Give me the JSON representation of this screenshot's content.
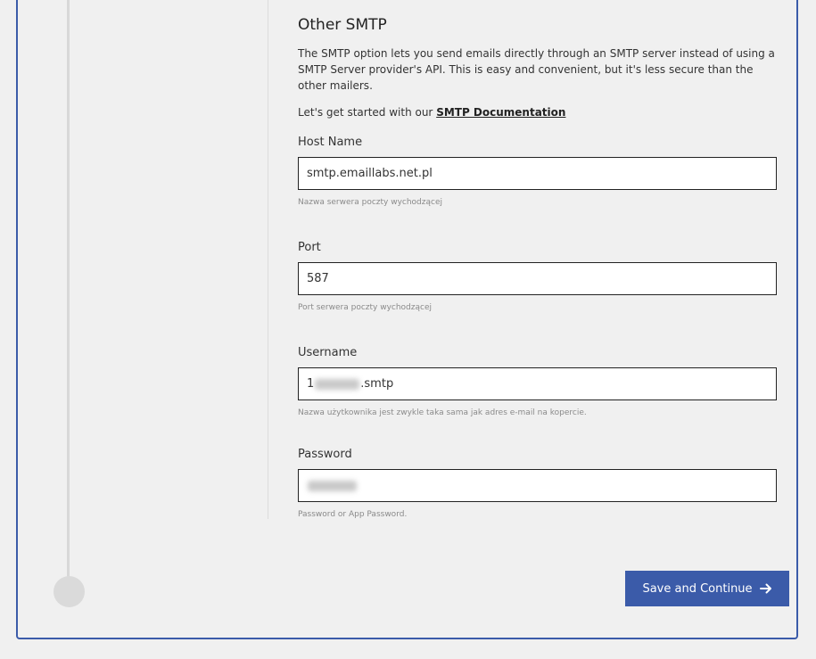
{
  "section": {
    "title": "Other SMTP",
    "description": "The SMTP option lets you send emails directly through an SMTP server instead of using a SMTP Server provider's API. This is easy and convenient, but it's less secure than the other mailers.",
    "intro_text": "Let's get started with our ",
    "doc_link": "SMTP Documentation"
  },
  "fields": {
    "host": {
      "label": "Host Name",
      "value": "smtp.emaillabs.net.pl",
      "hint": "Nazwa serwera poczty wychodzącej"
    },
    "port": {
      "label": "Port",
      "value": "587",
      "hint": "Port serwera poczty wychodzącej"
    },
    "username": {
      "label": "Username",
      "value_prefix": "1",
      "value_suffix": ".smtp",
      "hint": "Nazwa użytkownika jest zwykle taka sama jak adres e-mail na kopercie."
    },
    "password": {
      "label": "Password",
      "hint": "Password or App Password."
    }
  },
  "actions": {
    "save_label": "Save and Continue",
    "save_icon": "arrow-right-icon"
  },
  "colors": {
    "accent": "#3b5ba9",
    "background": "#f0f0f0"
  }
}
